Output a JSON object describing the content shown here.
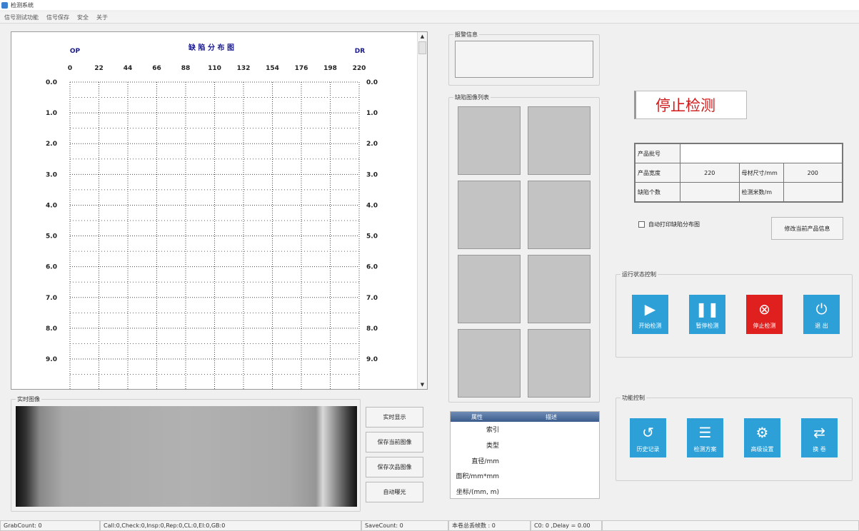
{
  "window": {
    "title": "检测系统"
  },
  "menu": [
    "信号测试功能",
    "信号保存",
    "安全",
    "关于"
  ],
  "chart": {
    "title": "缺 陷 分 布 图",
    "left_label": "OP",
    "right_label": "DR",
    "x_ticks": [
      "0",
      "22",
      "44",
      "66",
      "88",
      "110",
      "132",
      "154",
      "176",
      "198",
      "220"
    ],
    "y_ticks": [
      "0.0",
      "1.0",
      "2.0",
      "3.0",
      "4.0",
      "5.0",
      "6.0",
      "7.0",
      "8.0",
      "9.0"
    ]
  },
  "chart_data": {
    "type": "scatter",
    "title": "缺 陷 分 布 图",
    "xlabel": "",
    "ylabel": "",
    "xlim": [
      0,
      220
    ],
    "ylim": [
      0,
      9
    ],
    "x_ticks": [
      "0",
      "22",
      "44",
      "66",
      "88",
      "110",
      "132",
      "154",
      "176",
      "198",
      "220"
    ],
    "y_ticks": [
      "0.0",
      "1.0",
      "2.0",
      "3.0",
      "4.0",
      "5.0",
      "6.0",
      "7.0",
      "8.0",
      "9.0"
    ],
    "grid": true,
    "series": []
  },
  "live": {
    "title": "实时图像",
    "buttons": [
      "实时显示",
      "保存当前图像",
      "保存次品图像",
      "自动曝光"
    ]
  },
  "alarm": {
    "title": "报警信息",
    "text": ""
  },
  "defect_list": {
    "title": "缺陷图像列表"
  },
  "properties": {
    "headers": [
      "属性",
      "描述"
    ],
    "rows": [
      "索引",
      "类型",
      "直径/mm",
      "面积/mm*mm",
      "坐标/(mm, m)"
    ]
  },
  "status": {
    "text": "停止检测"
  },
  "product": {
    "batch_label": "产品批号",
    "batch_value": "",
    "width_label": "产品宽度",
    "width_value": "220",
    "size_label": "母材尺寸/mm",
    "size_value": "200",
    "defect_count_label": "缺陷个数",
    "defect_count_value": "",
    "meters_label": "检测米数/m",
    "meters_value": ""
  },
  "options": {
    "auto_print_label": "自动打印缺陷分布图",
    "auto_print_checked": false,
    "modify_button": "修改当前产品信息"
  },
  "control": {
    "title": "运行状态控制",
    "buttons": [
      {
        "label": "开始检测",
        "icon": "play-icon"
      },
      {
        "label": "暂停检测",
        "icon": "pause-icon"
      },
      {
        "label": "停止检测",
        "icon": "stop-icon"
      },
      {
        "label": "退 出",
        "icon": "power-icon"
      }
    ]
  },
  "function": {
    "title": "功能控制",
    "buttons": [
      {
        "label": "历史记录",
        "icon": "history-icon"
      },
      {
        "label": "检测方案",
        "icon": "document-icon"
      },
      {
        "label": "高级设置",
        "icon": "gear-icon"
      },
      {
        "label": "换 卷",
        "icon": "swap-icon"
      }
    ]
  },
  "statusbar": {
    "grab": "GrabCount: 0",
    "call": "Call:0,Check:0,Insp:0,Rep:0,CL:0,EI:0,GB:0",
    "save": "SaveCount: 0",
    "lost": "本卷总丢帧数 : 0",
    "delay": "C0: 0 ,Delay = 0.00"
  }
}
